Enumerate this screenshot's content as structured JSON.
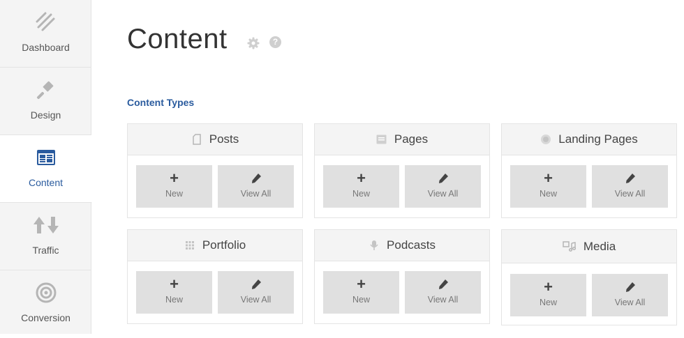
{
  "sidebar": {
    "items": [
      {
        "label": "Dashboard",
        "icon": "dashboard-icon",
        "active": false
      },
      {
        "label": "Design",
        "icon": "paintbrush-icon",
        "active": false
      },
      {
        "label": "Content",
        "icon": "content-grid-icon",
        "active": true
      },
      {
        "label": "Traffic",
        "icon": "traffic-arrows-icon",
        "active": false
      },
      {
        "label": "Conversion",
        "icon": "target-icon",
        "active": false
      }
    ]
  },
  "main": {
    "title": "Content",
    "section_title": "Content Types",
    "cards": [
      {
        "title": "Posts",
        "icon": "post-icon",
        "new_label": "New",
        "view_all_label": "View All"
      },
      {
        "title": "Pages",
        "icon": "page-icon",
        "new_label": "New",
        "view_all_label": "View All"
      },
      {
        "title": "Landing Pages",
        "icon": "landing-page-icon",
        "new_label": "New",
        "view_all_label": "View All"
      },
      {
        "title": "Portfolio",
        "icon": "grid-dots-icon",
        "new_label": "New",
        "view_all_label": "View All"
      },
      {
        "title": "Podcasts",
        "icon": "microphone-icon",
        "new_label": "New",
        "view_all_label": "View All"
      },
      {
        "title": "Media",
        "icon": "media-icon",
        "new_label": "New",
        "view_all_label": "View All"
      }
    ]
  },
  "colors": {
    "accent": "#2a5b9e",
    "sidebar_bg": "#f4f4f4",
    "button_bg": "#e0e0e0",
    "icon_grey": "#b5b5b5"
  }
}
